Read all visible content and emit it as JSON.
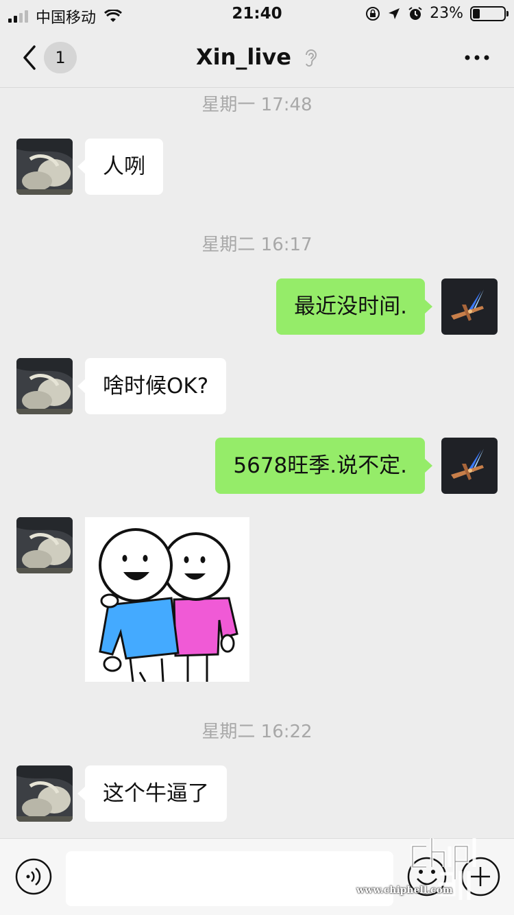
{
  "status_bar": {
    "carrier": "中国移动",
    "time": "21:40",
    "battery_percent": "23%",
    "battery_level": 0.23
  },
  "nav": {
    "unread_count": "1",
    "title": "Xin_live",
    "icons": [
      "chevron-left-icon",
      "ear-icon",
      "more-icon"
    ]
  },
  "messages": [
    {
      "type": "timestamp",
      "text": "星期一 17:48"
    },
    {
      "type": "text",
      "direction": "in",
      "text": "人咧"
    },
    {
      "type": "timestamp",
      "text": "星期二 16:17"
    },
    {
      "type": "text",
      "direction": "out",
      "text": "最近没时间."
    },
    {
      "type": "text",
      "direction": "in",
      "text": "啥时候OK?"
    },
    {
      "type": "text",
      "direction": "out",
      "text": "5678旺季.说不定."
    },
    {
      "type": "sticker",
      "direction": "in",
      "sticker": "two-friends-hugging"
    },
    {
      "type": "timestamp",
      "text": "星期二 16:22"
    },
    {
      "type": "text",
      "direction": "in",
      "text": "这个牛逼了"
    }
  ],
  "input_bar": {
    "placeholder": "",
    "icons": [
      "voice-icon",
      "emoji-icon",
      "plus-icon"
    ]
  },
  "watermark": {
    "logo_text": "chiphell",
    "url": "www.chiphell.com"
  },
  "colors": {
    "background": "#ededed",
    "incoming_bubble": "#ffffff",
    "outgoing_bubble": "#95ec69",
    "timestamp": "#a8a8a8"
  }
}
